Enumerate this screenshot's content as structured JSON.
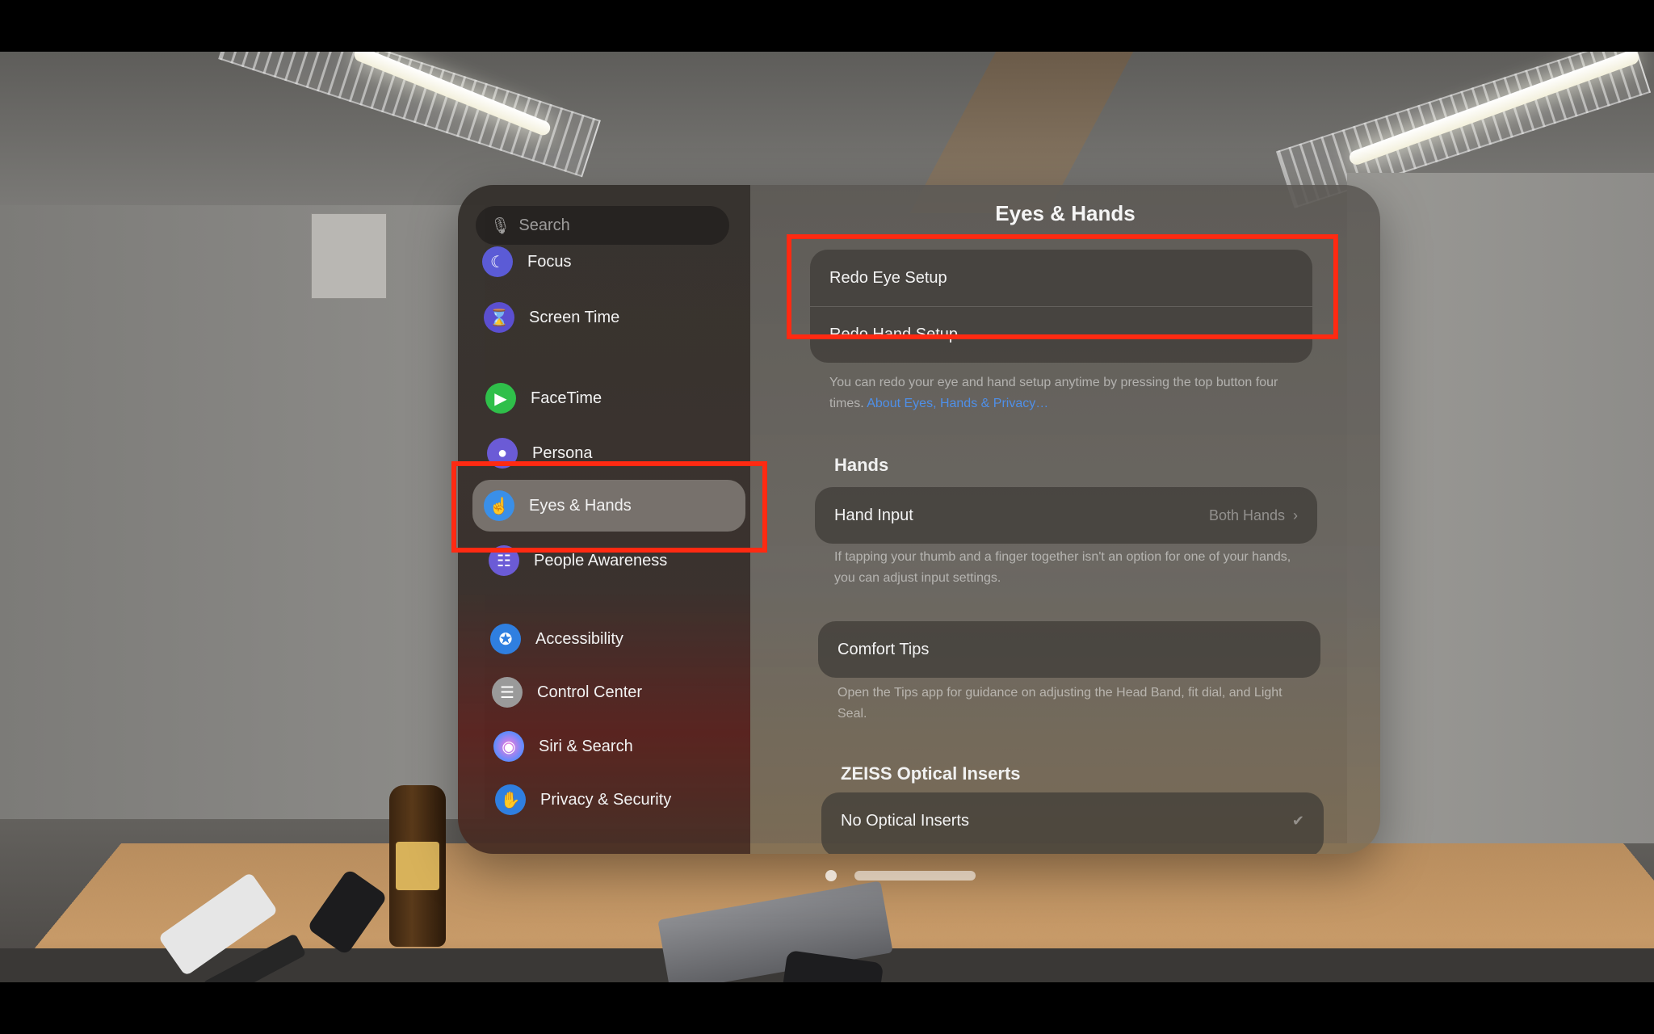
{
  "search": {
    "placeholder": "Search"
  },
  "sidebar": {
    "items": [
      {
        "label": "Focus",
        "icon": "moon-icon",
        "color": "#5b5bd6"
      },
      {
        "label": "Screen Time",
        "icon": "hourglass-icon",
        "color": "#5b4fd0"
      },
      {
        "label": "FaceTime",
        "icon": "video-icon",
        "color": "#2fbf4a"
      },
      {
        "label": "Persona",
        "icon": "person-icon",
        "color": "#6b5bd6"
      },
      {
        "label": "Eyes & Hands",
        "icon": "hand-pointer-icon",
        "color": "#3a8fe8"
      },
      {
        "label": "People Awareness",
        "icon": "people-icon",
        "color": "#6b5bd6"
      },
      {
        "label": "Accessibility",
        "icon": "accessibility-icon",
        "color": "#2f7fe0"
      },
      {
        "label": "Control Center",
        "icon": "toggles-icon",
        "color": "#9a9a9a"
      },
      {
        "label": "Siri & Search",
        "icon": "siri-icon",
        "color": "#b05ad8"
      },
      {
        "label": "Privacy & Security",
        "icon": "hand-raised-icon",
        "color": "#2f7fe0"
      }
    ],
    "selected": "Eyes & Hands"
  },
  "detail": {
    "title": "Eyes & Hands",
    "setup": {
      "redo_eye": "Redo Eye Setup",
      "redo_hand": "Redo Hand Setup",
      "note": "You can redo your eye and hand setup anytime by pressing the top button four times.",
      "note_link": "About Eyes, Hands & Privacy…"
    },
    "hands": {
      "header": "Hands",
      "hand_input_label": "Hand Input",
      "hand_input_value": "Both Hands",
      "note": "If tapping your thumb and a finger together isn't an option for one of your hands, you can adjust input settings."
    },
    "comfort": {
      "label": "Comfort Tips",
      "note": "Open the Tips app for guidance on adjusting the Head Band, fit dial, and Light Seal."
    },
    "zeiss": {
      "header": "ZEISS Optical Inserts",
      "option": "No Optical Inserts",
      "checked": true
    }
  },
  "colors": {
    "highlight": "#ff2a12"
  }
}
